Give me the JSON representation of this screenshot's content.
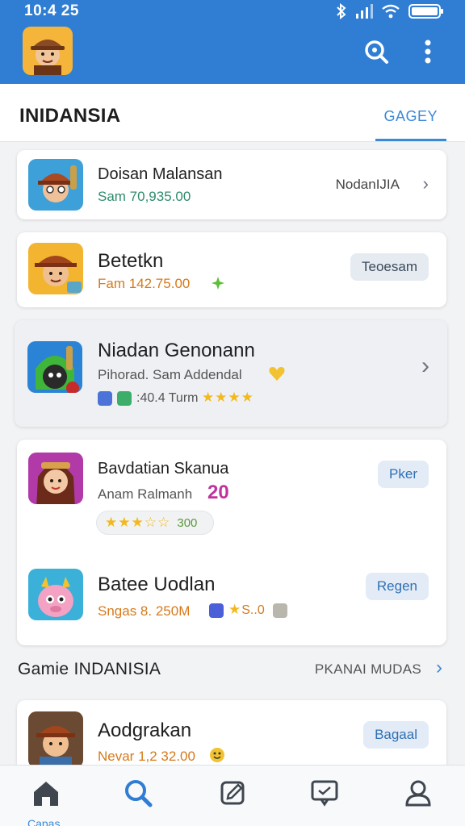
{
  "status_bar": {
    "time": "10:4 25"
  },
  "appbar": {
    "logo_icon": "game-character-avatar",
    "actions": [
      {
        "icon": "search-icon"
      },
      {
        "icon": "more-vertical-icon"
      }
    ],
    "color": "#2f7ed4"
  },
  "header": {
    "title": "INIDANSIA",
    "tab": "GAGEY"
  },
  "items": [
    {
      "name": "Doisan Malansan",
      "subtitle": "Sam 70,935.00",
      "right_text": "NodanIJIA",
      "icon": "hunter-character-icon"
    },
    {
      "name": "Betetkn",
      "subtitle": "Fam 142.75.00",
      "button": "Teoesam",
      "icon": "cowboy-character-icon"
    },
    {
      "name": "Niadan Genonann",
      "subtitle": "Pihorad. Sam Addendal",
      "meta": ":40.4 Turm",
      "stars": "★★★★",
      "icon": "green-hero-icon"
    },
    {
      "name": "Bavdatian Skanua",
      "subtitle": "Anam Ralmanh",
      "badge": "20",
      "rating_text": "300",
      "stars": "★★★☆☆",
      "button": "Pker",
      "icon": "princess-character-icon"
    },
    {
      "name": "Batee Uodlan",
      "subtitle": "Sngas 8. 250M",
      "meta": "S..0",
      "button": "Regen",
      "icon": "pink-creature-icon"
    }
  ],
  "section": {
    "title": "Gamie INDANISIA",
    "link": "PKANAI MUDAS"
  },
  "bottom_item": {
    "name": "Aodgrakan",
    "subtitle": "Nevar 1,2 32.00",
    "button": "Bagaal",
    "icon": "adventurer-character-icon"
  },
  "bottom_nav": [
    {
      "icon": "home-icon",
      "label": "Capas"
    },
    {
      "icon": "search-icon"
    },
    {
      "icon": "edit-icon"
    },
    {
      "icon": "chat-icon"
    },
    {
      "icon": "profile-icon"
    }
  ]
}
